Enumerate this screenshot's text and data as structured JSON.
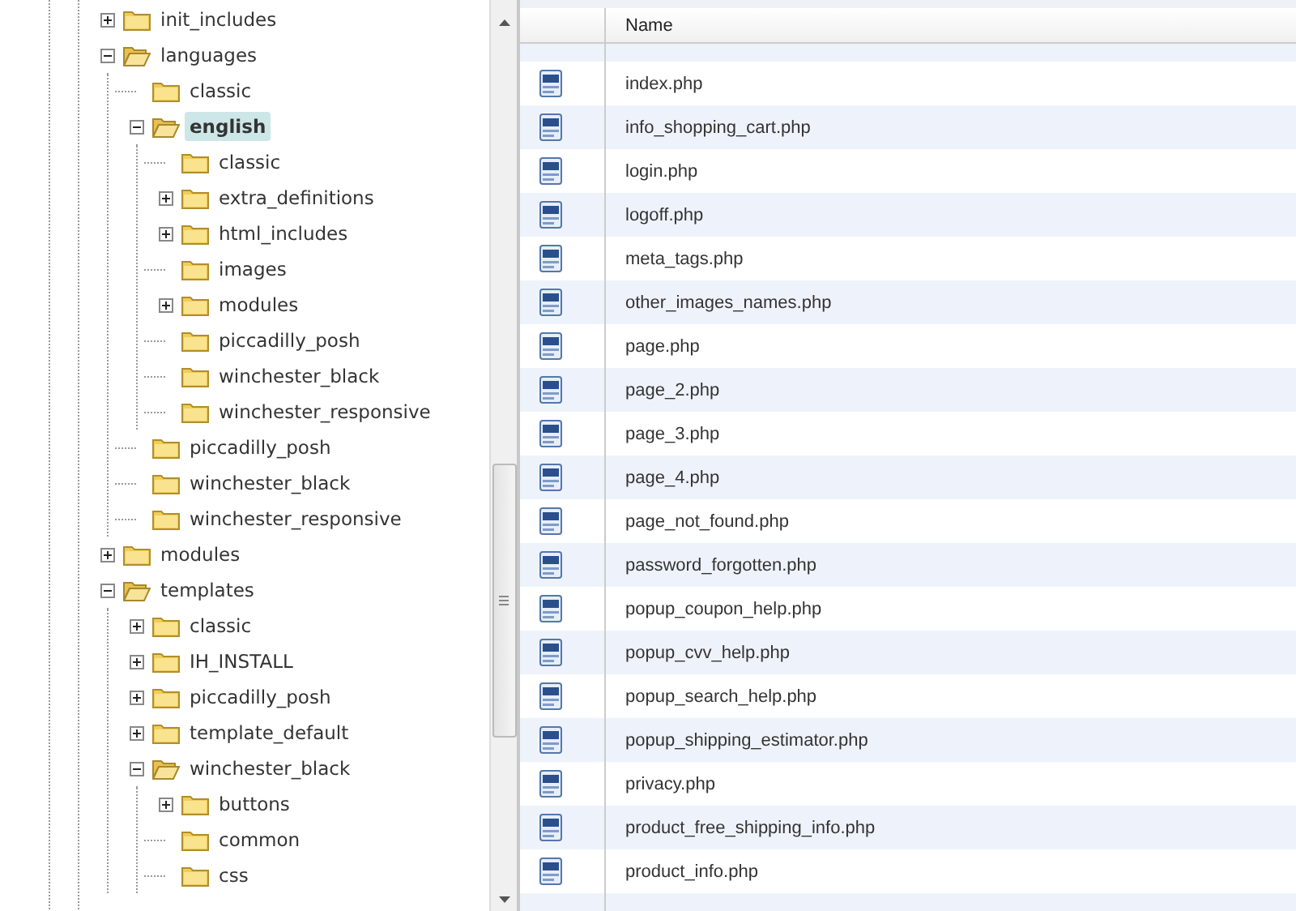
{
  "folder_tree": [
    {
      "label": "init_includes",
      "expanded": false,
      "selected": false
    },
    {
      "label": "languages",
      "expanded": true,
      "selected": false,
      "children": [
        {
          "label": "classic",
          "selected": false
        },
        {
          "label": "english",
          "expanded": true,
          "selected": true,
          "children": [
            {
              "label": "classic",
              "selected": false
            },
            {
              "label": "extra_definitions",
              "expanded": false,
              "selected": false
            },
            {
              "label": "html_includes",
              "expanded": false,
              "selected": false
            },
            {
              "label": "images",
              "selected": false
            },
            {
              "label": "modules",
              "expanded": false,
              "selected": false
            },
            {
              "label": "piccadilly_posh",
              "selected": false
            },
            {
              "label": "winchester_black",
              "selected": false
            },
            {
              "label": "winchester_responsive",
              "selected": false
            }
          ]
        },
        {
          "label": "piccadilly_posh",
          "selected": false
        },
        {
          "label": "winchester_black",
          "selected": false
        },
        {
          "label": "winchester_responsive",
          "selected": false
        }
      ]
    },
    {
      "label": "modules",
      "expanded": false,
      "selected": false
    },
    {
      "label": "templates",
      "expanded": true,
      "selected": false,
      "children": [
        {
          "label": "classic",
          "expanded": false,
          "selected": false
        },
        {
          "label": "IH_INSTALL",
          "expanded": false,
          "selected": false
        },
        {
          "label": "piccadilly_posh",
          "expanded": false,
          "selected": false
        },
        {
          "label": "template_default",
          "expanded": false,
          "selected": false
        },
        {
          "label": "winchester_black",
          "expanded": true,
          "selected": false,
          "children": [
            {
              "label": "buttons",
              "expanded": false,
              "selected": false
            },
            {
              "label": "common",
              "selected": false
            },
            {
              "label": "css",
              "selected": false
            }
          ]
        }
      ]
    }
  ],
  "file_table": {
    "columns": [
      "Name"
    ],
    "rows": [
      {
        "name": "index.php"
      },
      {
        "name": "info_shopping_cart.php"
      },
      {
        "name": "login.php"
      },
      {
        "name": "logoff.php"
      },
      {
        "name": "meta_tags.php"
      },
      {
        "name": "other_images_names.php"
      },
      {
        "name": "page.php"
      },
      {
        "name": "page_2.php"
      },
      {
        "name": "page_3.php"
      },
      {
        "name": "page_4.php"
      },
      {
        "name": "page_not_found.php"
      },
      {
        "name": "password_forgotten.php"
      },
      {
        "name": "popup_coupon_help.php"
      },
      {
        "name": "popup_cvv_help.php"
      },
      {
        "name": "popup_search_help.php"
      },
      {
        "name": "popup_shipping_estimator.php"
      },
      {
        "name": "privacy.php"
      },
      {
        "name": "product_free_shipping_info.php"
      },
      {
        "name": "product_info.php"
      }
    ]
  }
}
